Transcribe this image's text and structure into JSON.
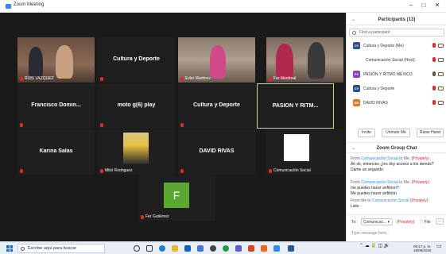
{
  "window": {
    "title": "Zoom Meeting",
    "minimize": "–",
    "maximize": "□",
    "close": "✕"
  },
  "gallery": {
    "tiles": [
      {
        "label": "RUBI VAZQUEZ",
        "center": ""
      },
      {
        "label": "",
        "center": "Cultura y Deporte"
      },
      {
        "label": "Evler Martinez",
        "center": ""
      },
      {
        "label": "Fer Montreal",
        "center": ""
      },
      {
        "label": "",
        "center": "Francisco Domin..."
      },
      {
        "label": "",
        "center": "moto g(6) play"
      },
      {
        "label": "",
        "center": "Cultura y Deporte"
      },
      {
        "label": "",
        "center": "PASIÓN Y RITM..."
      },
      {
        "label": "",
        "center": "Karina Salas"
      },
      {
        "label": "Mitzi Rodriguez",
        "center": ""
      },
      {
        "label": "",
        "center": "DAVID RIVAS"
      },
      {
        "label": "Comunicación Social",
        "center": ""
      },
      {
        "label": "Fer Gutiérrez",
        "center": "",
        "initial": "F"
      }
    ]
  },
  "participants": {
    "header": "Participants (13)",
    "search_placeholder": "Find a participant",
    "list": [
      {
        "initials": "CY",
        "name": "Cultura y Deporte (Me)",
        "color": "#2b4e8c"
      },
      {
        "initials": "",
        "name": "Comunicación Social (Host)",
        "color": "#ffffff"
      },
      {
        "initials": "PY",
        "name": "PASIÓN Y RITMO MÉXICO",
        "color": "#8a3fc6"
      },
      {
        "initials": "CY",
        "name": "Cultura y Deporte",
        "color": "#2b4e8c"
      },
      {
        "initials": "DR",
        "name": "DAVID RIVAS",
        "color": "#e87722"
      }
    ],
    "buttons": {
      "invite": "Invite",
      "unmute": "Unmute Me",
      "raise_hand": "Raise Hand"
    }
  },
  "chat": {
    "header": "Zoom Group Chat",
    "messages": [
      {
        "from": "From",
        "sender": "Comunicación Social",
        "to": "to Me:",
        "privately": "(Privately)",
        "lines": [
          "Ah ok, entonces ¿les doy acceso a los demás?",
          "Dame un segundo"
        ]
      },
      {
        "from": "From",
        "sender": "Comunicación Social",
        "to": "to Me:",
        "privately": "(Privately)",
        "lines": [
          "me puedes hacer anfitrion?",
          "Me puedes hacer anfitrión"
        ]
      },
      {
        "from": "From Me to",
        "sender": "Comunicación Social",
        "to": "",
        "privately": "(Privately)",
        "lines": [
          "Listo"
        ]
      }
    ],
    "to_label": "To:",
    "recipient": "Comunicac...",
    "privately": "(Privately)",
    "file_label": "File",
    "more": "···",
    "input_placeholder": "Type message here..."
  },
  "taskbar": {
    "search_placeholder": "Escribe aquí para buscar",
    "time": "09:17 p. m.",
    "date": "18/08/2020"
  },
  "colors": {
    "accent": "#2d8cff",
    "muted": "#e02828",
    "active_speaker": "#c8e632",
    "gallery_bg": "#1a1a1a"
  }
}
